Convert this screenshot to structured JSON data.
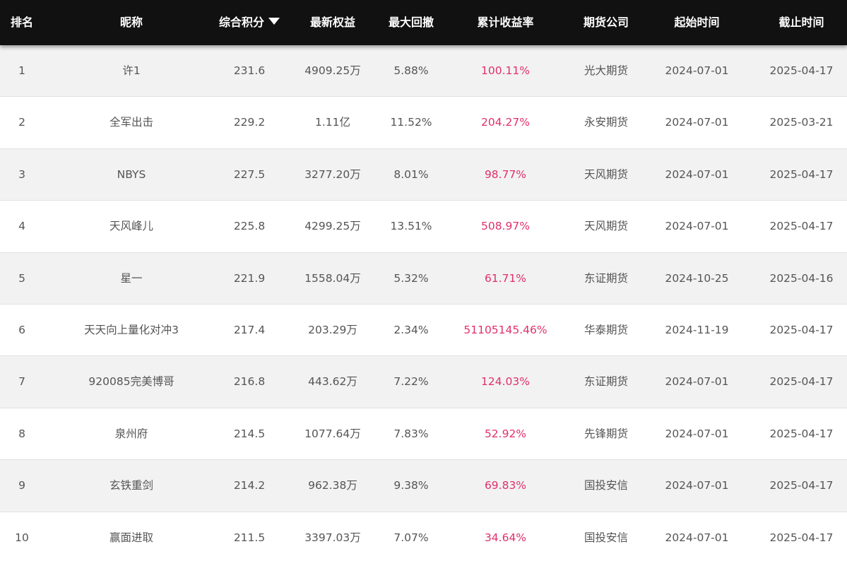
{
  "header": {
    "rank": "排名",
    "name": "昵称",
    "score": "综合积分",
    "equity": "最新权益",
    "drawdown": "最大回撤",
    "return": "累计收益率",
    "company": "期货公司",
    "start": "起始时间",
    "end": "截止时间"
  },
  "colors": {
    "header_bg": "#111111",
    "return_text": "#e0306e",
    "row_alt_bg": "#f2f2f2"
  },
  "rows": [
    {
      "rank": "1",
      "name": "许1",
      "score": "231.6",
      "equity": "4909.25万",
      "drawdown": "5.88%",
      "return": "100.11%",
      "company": "光大期货",
      "start": "2024-07-01",
      "end": "2025-04-17"
    },
    {
      "rank": "2",
      "name": "全军出击",
      "score": "229.2",
      "equity": "1.11亿",
      "drawdown": "11.52%",
      "return": "204.27%",
      "company": "永安期货",
      "start": "2024-07-01",
      "end": "2025-03-21"
    },
    {
      "rank": "3",
      "name": "NBYS",
      "score": "227.5",
      "equity": "3277.20万",
      "drawdown": "8.01%",
      "return": "98.77%",
      "company": "天风期货",
      "start": "2024-07-01",
      "end": "2025-04-17"
    },
    {
      "rank": "4",
      "name": "天风峰儿",
      "score": "225.8",
      "equity": "4299.25万",
      "drawdown": "13.51%",
      "return": "508.97%",
      "company": "天风期货",
      "start": "2024-07-01",
      "end": "2025-04-17"
    },
    {
      "rank": "5",
      "name": "星一",
      "score": "221.9",
      "equity": "1558.04万",
      "drawdown": "5.32%",
      "return": "61.71%",
      "company": "东证期货",
      "start": "2024-10-25",
      "end": "2025-04-16"
    },
    {
      "rank": "6",
      "name": "天天向上量化对冲3",
      "score": "217.4",
      "equity": "203.29万",
      "drawdown": "2.34%",
      "return": "51105145.46%",
      "company": "华泰期货",
      "start": "2024-11-19",
      "end": "2025-04-17"
    },
    {
      "rank": "7",
      "name": "920085完美博哥",
      "score": "216.8",
      "equity": "443.62万",
      "drawdown": "7.22%",
      "return": "124.03%",
      "company": "东证期货",
      "start": "2024-07-01",
      "end": "2025-04-17"
    },
    {
      "rank": "8",
      "name": "泉州府",
      "score": "214.5",
      "equity": "1077.64万",
      "drawdown": "7.83%",
      "return": "52.92%",
      "company": "先锋期货",
      "start": "2024-07-01",
      "end": "2025-04-17"
    },
    {
      "rank": "9",
      "name": "玄铁重剑",
      "score": "214.2",
      "equity": "962.38万",
      "drawdown": "9.38%",
      "return": "69.83%",
      "company": "国投安信",
      "start": "2024-07-01",
      "end": "2025-04-17"
    },
    {
      "rank": "10",
      "name": "赢面进取",
      "score": "211.5",
      "equity": "3397.03万",
      "drawdown": "7.07%",
      "return": "34.64%",
      "company": "国投安信",
      "start": "2024-07-01",
      "end": "2025-04-17"
    }
  ]
}
